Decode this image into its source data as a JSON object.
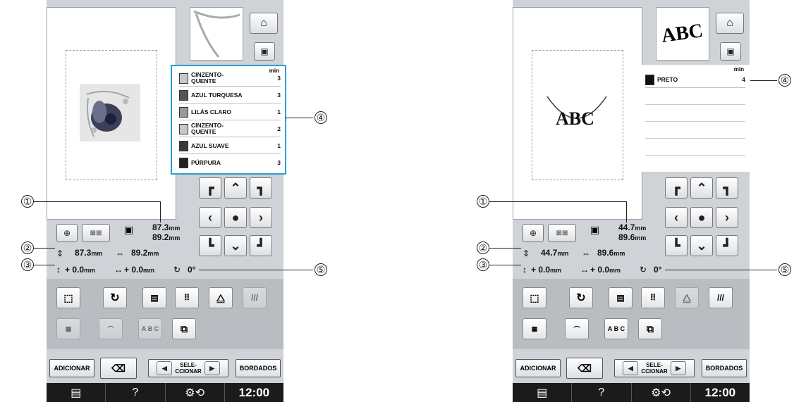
{
  "left": {
    "threads": [
      {
        "name": "CINZENTO-\nQUENTE",
        "min": "3"
      },
      {
        "name": "AZUL TURQUESA",
        "min": "3"
      },
      {
        "name": "LILÁS CLARO",
        "min": "1"
      },
      {
        "name": "CINZENTO-\nQUENTE",
        "min": "2"
      },
      {
        "name": "AZUL SUAVE",
        "min": "1"
      },
      {
        "name": "PÚRPURA",
        "min": "3"
      }
    ],
    "min_header": "min",
    "size_h": "87.3",
    "size_w": "89.2",
    "unit": "mm",
    "dim_h": "87.3",
    "dim_w": "89.2",
    "offset_v": "0.0",
    "offset_h": "0.0",
    "angle": "0°",
    "plus": "+"
  },
  "right": {
    "threads": [
      {
        "name": "PRETO",
        "min": "4"
      }
    ],
    "min_header": "min",
    "size_h": "44.7",
    "size_w": "89.6",
    "unit": "mm",
    "dim_h": "44.7",
    "dim_w": "89.6",
    "offset_v": "0.0",
    "offset_h": "0.0",
    "angle": "0°",
    "plus": "+",
    "preview_text": "ABC"
  },
  "buttons": {
    "adicionar": "ADICIONAR",
    "selecionar": "SELE-\nCCIONAR",
    "bordados": "BORDADOS"
  },
  "status": {
    "help": "?",
    "time": "12:00"
  },
  "callouts": [
    "①",
    "②",
    "③",
    "④",
    "⑤"
  ],
  "tool_labels": {
    "abc": "A B C"
  }
}
